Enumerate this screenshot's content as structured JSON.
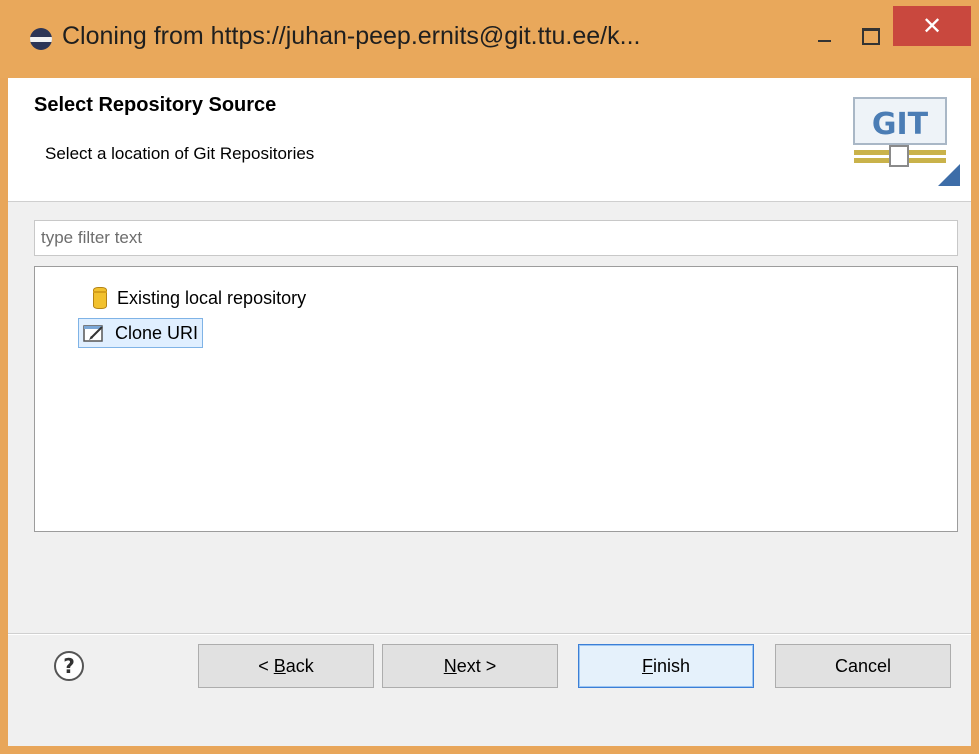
{
  "window": {
    "title": "Cloning from https://juhan-peep.ernits@git.ttu.ee/k...",
    "close_glyph": "✕"
  },
  "header": {
    "title": "Select Repository Source",
    "subtitle": "Select a location of Git Repositories",
    "logo_text": "GIT"
  },
  "filter": {
    "placeholder": "type filter text",
    "value": ""
  },
  "tree": {
    "items": [
      {
        "label": "Existing local repository",
        "icon": "database-icon",
        "selected": false
      },
      {
        "label": "Clone URI",
        "icon": "clone-uri-icon",
        "selected": true
      }
    ]
  },
  "buttons": {
    "help": "?",
    "back": {
      "mnemonic": "B",
      "prefix": "< ",
      "rest": "ack"
    },
    "next": {
      "mnemonic": "N",
      "rest": "ext >"
    },
    "finish": {
      "mnemonic": "F",
      "rest": "inish"
    },
    "cancel": "Cancel"
  },
  "colors": {
    "title_bar": "#e9a85b",
    "close_button": "#c9483e",
    "selection": "#e0efff",
    "default_button_border": "#3c7fd6"
  }
}
